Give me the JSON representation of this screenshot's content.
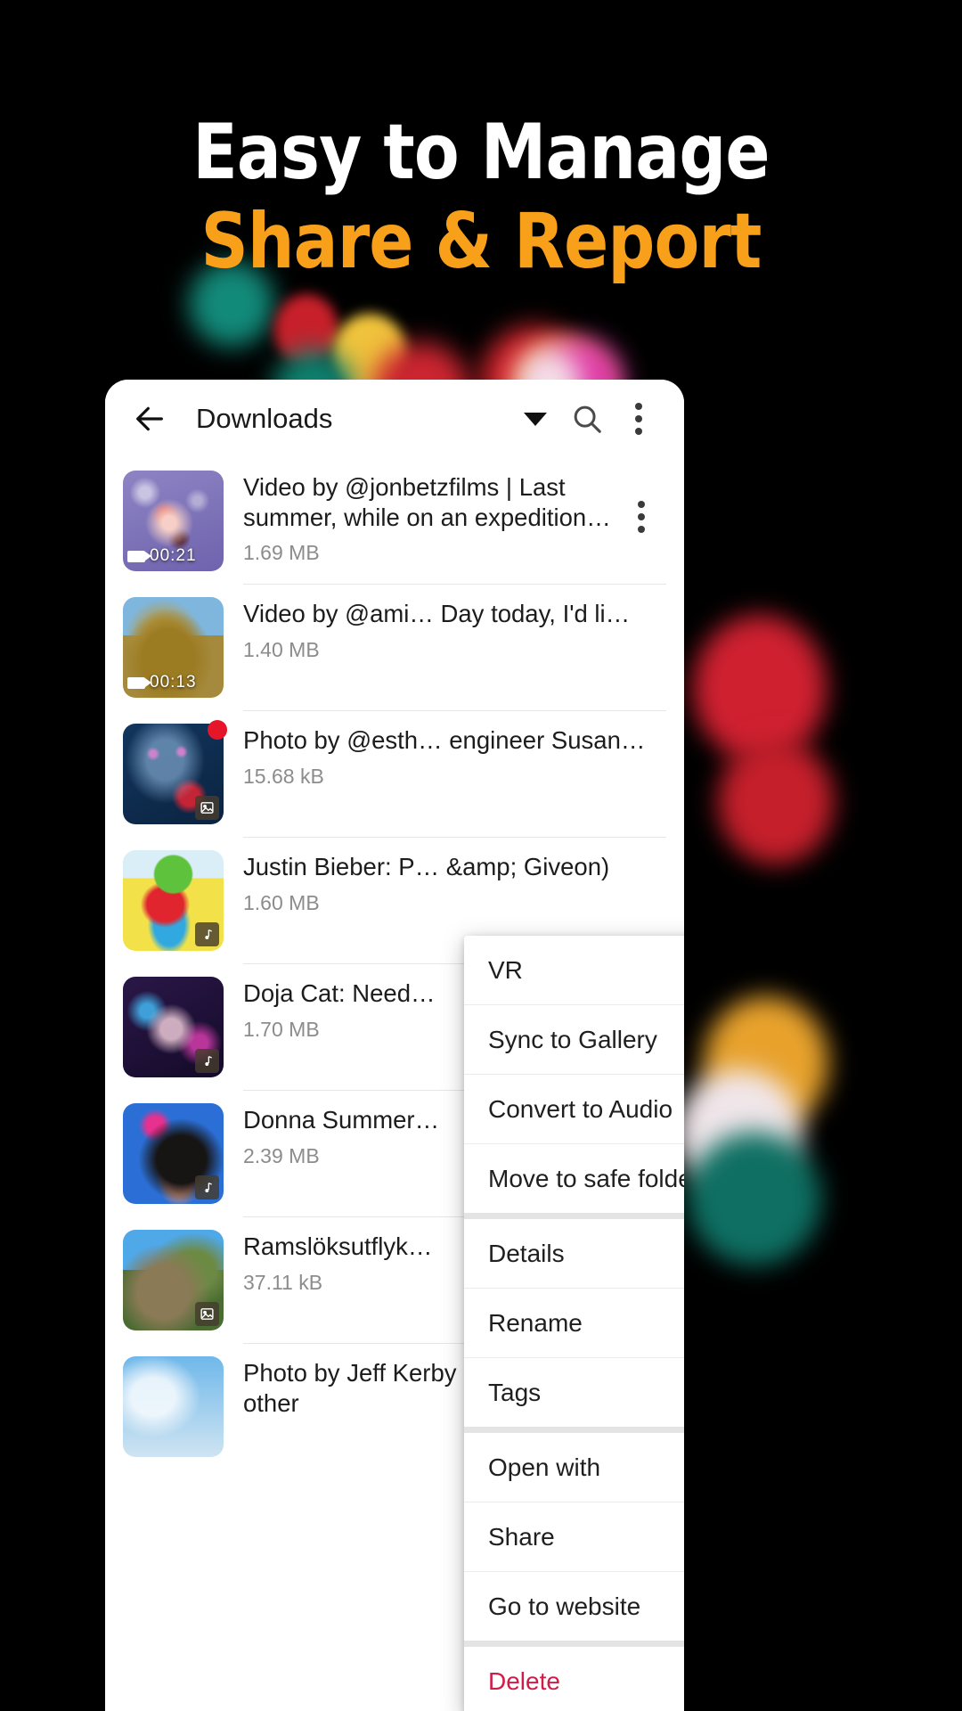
{
  "promo": {
    "line1": "Easy to Manage",
    "line2": "Share & Report",
    "line1_color": "#ffffff",
    "line2_color": "#f9a01b"
  },
  "toolbar": {
    "back_icon": "arrow-left-icon",
    "title": "Downloads",
    "caret_icon": "chevron-down-icon",
    "search_icon": "search-icon",
    "overflow_icon": "more-vertical-icon"
  },
  "list": [
    {
      "title": "Video by @jonbetzfilms | Last summer, while on an expedition dive in remote nort…",
      "size": "1.69 MB",
      "duration": "00:21",
      "badge": "video",
      "has_row_menu": true,
      "red_dot": false,
      "thumb": "jellyfish-purple"
    },
    {
      "title": "Video by @ami… Day today, I'd li…",
      "size": "1.40 MB",
      "duration": "00:13",
      "badge": "video",
      "has_row_menu": false,
      "red_dot": false,
      "thumb": "rhino-field"
    },
    {
      "title": "Photo by @esth… engineer Susan…",
      "size": "15.68 kB",
      "duration": "",
      "badge": "image",
      "has_row_menu": false,
      "red_dot": true,
      "thumb": "stage-blue"
    },
    {
      "title": "Justin Bieber: P… &amp; Giveon)",
      "size": "1.60 MB",
      "duration": "",
      "badge": "audio",
      "has_row_menu": false,
      "red_dot": false,
      "thumb": "gulli-dance-kids"
    },
    {
      "title": "Doja Cat: Need…",
      "size": "1.70 MB",
      "duration": "",
      "badge": "audio",
      "has_row_menu": false,
      "red_dot": false,
      "thumb": "doja-purple"
    },
    {
      "title": "Donna Summer…",
      "size": "2.39 MB",
      "duration": "",
      "badge": "audio",
      "has_row_menu": false,
      "red_dot": false,
      "thumb": "donna-blue"
    },
    {
      "title": "Ramslöksutflyk…",
      "size": "37.11 kB",
      "duration": "",
      "badge": "image",
      "has_row_menu": false,
      "red_dot": false,
      "thumb": "forest-tree"
    },
    {
      "title": "Photo by Jeff Kerby @jtkerby | What other",
      "size": "",
      "duration": "",
      "badge": "",
      "has_row_menu": false,
      "red_dot": false,
      "thumb": "sky-clouds"
    }
  ],
  "context_menu": {
    "groups": [
      [
        {
          "label": "VR",
          "icon": "cube-3d-icon",
          "danger": false
        },
        {
          "label": "Sync to Gallery",
          "icon": "add-to-stack-icon",
          "danger": false
        },
        {
          "label": "Convert to Audio",
          "icon": "audio-file-icon",
          "danger": false
        },
        {
          "label": "Move to safe folder",
          "icon": "lock-icon",
          "danger": false
        }
      ],
      [
        {
          "label": "Details",
          "icon": "info-circle-icon",
          "danger": false
        },
        {
          "label": "Rename",
          "icon": "text-t-icon",
          "danger": false
        },
        {
          "label": "Tags",
          "icon": "tag-icon",
          "danger": false
        }
      ],
      [
        {
          "label": "Open with",
          "icon": "move-arrows-icon",
          "danger": false
        },
        {
          "label": "Share",
          "icon": "share-nodes-icon",
          "danger": false
        },
        {
          "label": "Go to website",
          "icon": "link-icon",
          "danger": false
        }
      ],
      [
        {
          "label": "Delete",
          "icon": "trash-icon",
          "danger": true
        }
      ]
    ],
    "danger_color": "#d01c49"
  }
}
